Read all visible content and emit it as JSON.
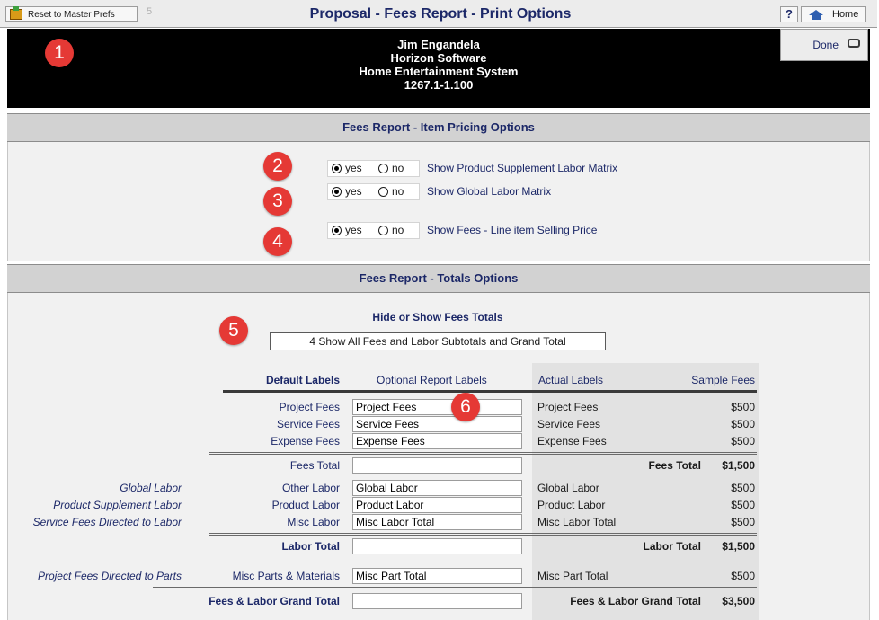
{
  "toolbar": {
    "reset_label": "Reset to Master Prefs",
    "counter": "5",
    "title": "Proposal - Fees Report - Print Options",
    "help_label": "?",
    "home_label": "Home",
    "done_label": "Done"
  },
  "header": {
    "lines": [
      "Jim Engandela",
      "Horizon Software",
      "Home Entertainment System",
      "1267.1-1.100"
    ]
  },
  "badges": [
    "1",
    "2",
    "3",
    "4",
    "5",
    "6"
  ],
  "item_pricing": {
    "title": "Fees Report - Item Pricing Options",
    "options": [
      {
        "yes": "yes",
        "no": "no",
        "selected": "yes",
        "label": "Show Product Supplement Labor Matrix"
      },
      {
        "yes": "yes",
        "no": "no",
        "selected": "yes",
        "label": "Show Global Labor Matrix"
      },
      {
        "yes": "yes",
        "no": "no",
        "selected": "yes",
        "label": "Show Fees - Line item Selling Price"
      }
    ]
  },
  "totals": {
    "title": "Fees Report - Totals Options",
    "hide_show_heading": "Hide or Show Fees Totals",
    "hide_show_value": "4 Show All Fees and Labor Subtotals and Grand Total",
    "columns": {
      "default": "Default Labels",
      "optional": "Optional Report Labels",
      "actual": "Actual Labels",
      "sample": "Sample Fees"
    },
    "fees_rows": [
      {
        "default": "Project Fees",
        "optional": "Project Fees",
        "actual": "Project Fees",
        "sample": "$500"
      },
      {
        "default": "Service Fees",
        "optional": "Service Fees",
        "actual": "Service Fees",
        "sample": "$500"
      },
      {
        "default": "Expense Fees",
        "optional": "Expense Fees",
        "actual": "Expense Fees",
        "sample": "$500"
      }
    ],
    "fees_total": {
      "default": "Fees Total",
      "optional": "",
      "actual": "Fees Total",
      "sample": "$1,500"
    },
    "labor_rows": [
      {
        "source": "Global Labor",
        "default": "Other Labor",
        "optional": "Global Labor",
        "actual": "Global Labor",
        "sample": "$500"
      },
      {
        "source": "Product Supplement Labor",
        "default": "Product Labor",
        "optional": "Product Labor",
        "actual": "Product Labor",
        "sample": "$500"
      },
      {
        "source": "Service Fees Directed to Labor",
        "default": "Misc Labor",
        "optional": "Misc Labor Total",
        "actual": "Misc Labor Total",
        "sample": "$500"
      }
    ],
    "labor_total": {
      "default": "Labor Total",
      "optional": "",
      "actual": "Labor Total",
      "sample": "$1,500"
    },
    "parts_row": {
      "source": "Project Fees Directed to Parts",
      "default": "Misc Parts & Materials",
      "optional": "Misc Part Total",
      "actual": "Misc Part Total",
      "sample": "$500"
    },
    "grand_total": {
      "default": "Fees & Labor Grand Total",
      "optional": "",
      "actual": "Fees & Labor Grand Total",
      "sample": "$3,500"
    }
  }
}
